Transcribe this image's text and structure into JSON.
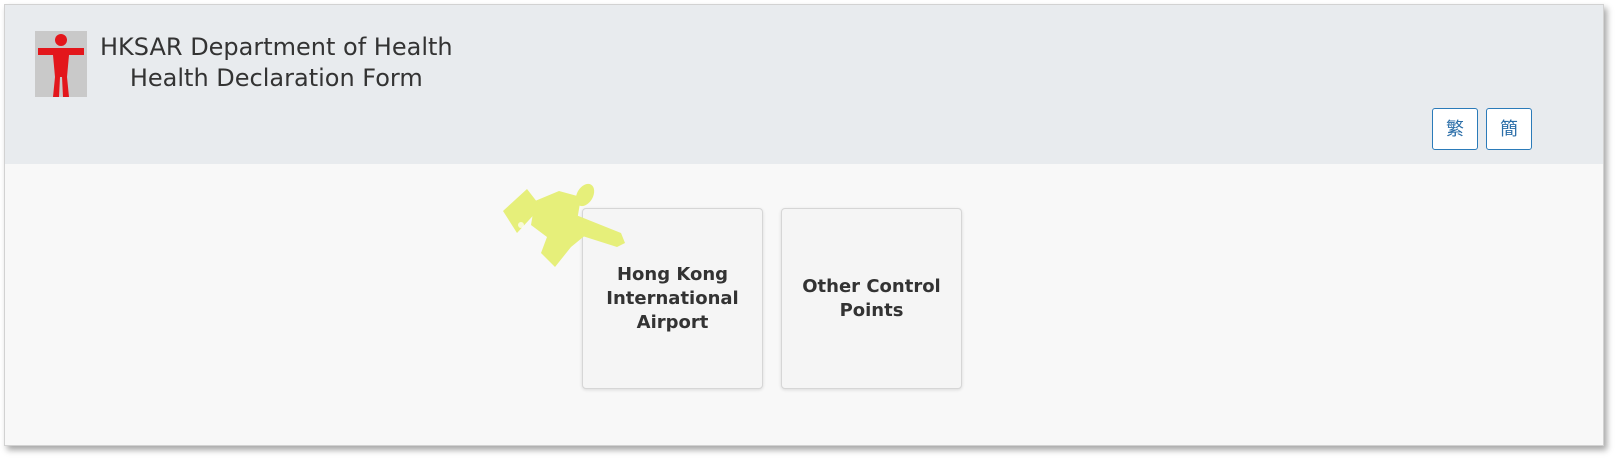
{
  "header": {
    "title_line1": "HKSAR Department of Health",
    "title_line2": "Health Declaration Form",
    "logo_icon": "dh-figure-logo-icon"
  },
  "language": {
    "traditional_label": "繁",
    "simplified_label": "簡"
  },
  "options": [
    {
      "label": "Hong Kong International Airport"
    },
    {
      "label": "Other Control Points"
    }
  ],
  "annotation": {
    "icon": "pointing-hand-icon",
    "color": "#e6ef7a"
  },
  "colors": {
    "header_bg": "#e8ebee",
    "logo_red": "#e3161b",
    "logo_gray": "#c9c9c9",
    "button_border": "#2b7bb9"
  }
}
